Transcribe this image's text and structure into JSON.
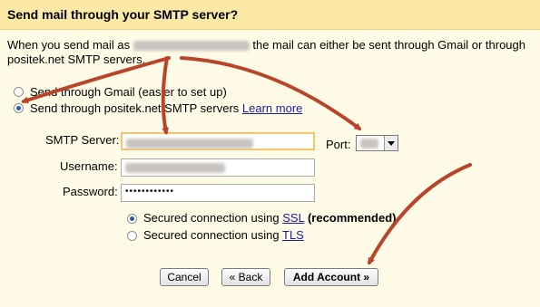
{
  "header": {
    "title": "Send mail through your SMTP server?"
  },
  "description": {
    "prefix": "When you send mail as",
    "suffix": "the mail can either be sent through Gmail or through",
    "line2": "positek.net SMTP servers."
  },
  "options": {
    "gmail_label": "Send through Gmail (easier to set up)",
    "smtp_label": "Send through positek.net SMTP servers",
    "learn_more": "Learn more"
  },
  "form": {
    "smtp_server_label": "SMTP Server:",
    "port_label": "Port:",
    "username_label": "Username:",
    "password_label": "Password:",
    "password_value": "••••••••••••"
  },
  "security": {
    "ssl_prefix": "Secured connection using",
    "ssl_link": "SSL",
    "ssl_suffix": "(recommended)",
    "tls_prefix": "Secured connection using",
    "tls_link": "TLS"
  },
  "buttons": {
    "cancel": "Cancel",
    "back": "« Back",
    "add_account": "Add Account »"
  },
  "colors": {
    "background": "#fffbe6",
    "header": "#fde9a6",
    "arrow": "#b8452a",
    "link": "#1a1aa6"
  }
}
